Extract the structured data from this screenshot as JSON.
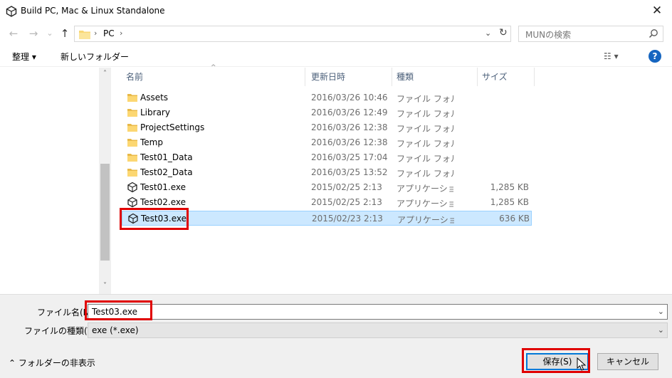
{
  "window": {
    "title": "Build PC, Mac & Linux Standalone",
    "close": "✕"
  },
  "nav": {
    "back": "←",
    "forward": "→",
    "recent": "⌄",
    "up": "↑"
  },
  "address": {
    "crumb": "PC",
    "sep": "›",
    "dropdown": "⌄",
    "refresh": "↻"
  },
  "search": {
    "placeholder": "MUNの検索"
  },
  "toolbar": {
    "organize": "整理 ▾",
    "new_folder": "新しいフォルダー",
    "view": "☷ ▾",
    "help": "?"
  },
  "columns": {
    "name": "名前",
    "date": "更新日時",
    "type": "種類",
    "size": "サイズ",
    "sort_hint": "^"
  },
  "files": [
    {
      "name": "Assets",
      "date": "2016/03/26 10:46",
      "type": "ファイル フォルダー",
      "size": "",
      "icon": "folder-icon"
    },
    {
      "name": "Library",
      "date": "2016/03/26 12:49",
      "type": "ファイル フォルダー",
      "size": "",
      "icon": "folder-icon"
    },
    {
      "name": "ProjectSettings",
      "date": "2016/03/26 12:38",
      "type": "ファイル フォルダー",
      "size": "",
      "icon": "folder-icon"
    },
    {
      "name": "Temp",
      "date": "2016/03/26 12:38",
      "type": "ファイル フォルダー",
      "size": "",
      "icon": "folder-icon"
    },
    {
      "name": "Test01_Data",
      "date": "2016/03/25 17:04",
      "type": "ファイル フォルダー",
      "size": "",
      "icon": "folder-icon"
    },
    {
      "name": "Test02_Data",
      "date": "2016/03/25 13:52",
      "type": "ファイル フォルダー",
      "size": "",
      "icon": "folder-icon"
    },
    {
      "name": "Test01.exe",
      "date": "2015/02/25 2:13",
      "type": "アプリケーション",
      "size": "1,285 KB",
      "icon": "unity-app-icon"
    },
    {
      "name": "Test02.exe",
      "date": "2015/02/25 2:13",
      "type": "アプリケーション",
      "size": "1,285 KB",
      "icon": "unity-app-icon"
    },
    {
      "name": "Test03.exe",
      "date": "2015/02/23 2:13",
      "type": "アプリケーション",
      "size": "636 KB",
      "icon": "unity-app-icon",
      "selected": true
    }
  ],
  "scrollbar": {
    "up": "˄",
    "down": "˅"
  },
  "form": {
    "filename_label": "ファイル名(N):",
    "filename_value": "Test03.exe",
    "filetype_label": "ファイルの種類(T):",
    "filetype_value": "exe (*.exe)",
    "dropdown": "⌄"
  },
  "footer": {
    "hide_folders": "⌃  フォルダーの非表示",
    "save": "保存(S)",
    "cancel": "キャンセル"
  },
  "colors": {
    "highlight": "#e00000",
    "selection": "#cce8ff",
    "accent": "#0078d7"
  }
}
